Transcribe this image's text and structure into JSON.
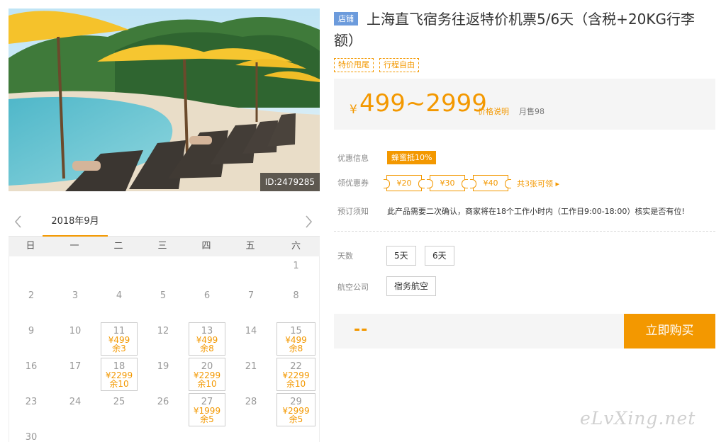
{
  "photo": {
    "id_label": "ID:2479285"
  },
  "calendar": {
    "month": "2018年9月",
    "weekdays": [
      "日",
      "一",
      "二",
      "三",
      "四",
      "五",
      "六"
    ],
    "rows": [
      [
        {
          "d": ""
        },
        {
          "d": ""
        },
        {
          "d": ""
        },
        {
          "d": ""
        },
        {
          "d": ""
        },
        {
          "d": ""
        },
        {
          "d": "1"
        }
      ],
      [
        {
          "d": "2"
        },
        {
          "d": "3"
        },
        {
          "d": "4"
        },
        {
          "d": "5"
        },
        {
          "d": "6"
        },
        {
          "d": "7"
        },
        {
          "d": "8"
        }
      ],
      [
        {
          "d": "9"
        },
        {
          "d": "10"
        },
        {
          "d": "11",
          "p": "¥499",
          "s": "余3"
        },
        {
          "d": "12"
        },
        {
          "d": "13",
          "p": "¥499",
          "s": "余8"
        },
        {
          "d": "14"
        },
        {
          "d": "15",
          "p": "¥499",
          "s": "余8"
        }
      ],
      [
        {
          "d": "16"
        },
        {
          "d": "17"
        },
        {
          "d": "18",
          "p": "¥2299",
          "s": "余10"
        },
        {
          "d": "19"
        },
        {
          "d": "20",
          "p": "¥2299",
          "s": "余10"
        },
        {
          "d": "21"
        },
        {
          "d": "22",
          "p": "¥2299",
          "s": "余10"
        }
      ],
      [
        {
          "d": "23"
        },
        {
          "d": "24"
        },
        {
          "d": "25"
        },
        {
          "d": "26"
        },
        {
          "d": "27",
          "p": "¥1999",
          "s": "余5"
        },
        {
          "d": "28"
        },
        {
          "d": "29",
          "p": "¥2999",
          "s": "余5"
        }
      ],
      [
        {
          "d": "30"
        },
        {
          "d": ""
        },
        {
          "d": ""
        },
        {
          "d": ""
        },
        {
          "d": ""
        },
        {
          "d": ""
        },
        {
          "d": ""
        }
      ]
    ]
  },
  "product": {
    "shop_tag": "店铺",
    "title": "上海直飞宿务往返特价机票5/6天（含税+20KG行李额）",
    "labels": [
      "特价甩尾",
      "行程自由"
    ],
    "price_symbol": "¥",
    "price_range": "499~2999",
    "price_link": "价格说明",
    "monthly_sales": "月售98"
  },
  "offers": {
    "promo_label": "优惠信息",
    "promo_badge": "蜂蜜抵10%",
    "coupon_label": "领优惠券",
    "coupons": [
      "¥20",
      "¥30",
      "¥40"
    ],
    "coupons_more": "共3张可领 ▸",
    "notice_label": "预订须知",
    "notice_text": "此产品需要二次确认，商家将在18个工作小时内（工作日9:00-18:00）核实是否有位!"
  },
  "options": {
    "days_label": "天数",
    "days": [
      "5天",
      "6天"
    ],
    "airline_label": "航空公司",
    "airline": "宿务航空"
  },
  "buy": {
    "price_placeholder": "--",
    "button": "立即购买"
  },
  "watermark": "eLvXing.net",
  "colors": {
    "accent": "#f39800",
    "shop_tag": "#6c9bdc"
  }
}
